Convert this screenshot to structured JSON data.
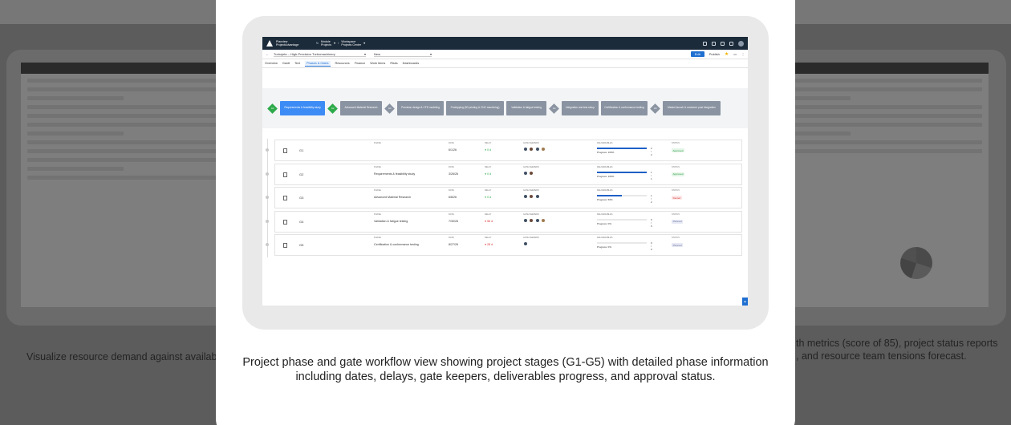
{
  "background": {
    "left_caption": "Visualize resource demand against availab",
    "right_caption": "th metrics (score of 85), project status reports\n, and resource team tensions forecast."
  },
  "modal": {
    "caption": "Project phase and gate workflow view showing project stages (G1-G5) with detailed phase information including dates, delays, gate keepers, deliverables progress, and approval status."
  },
  "app": {
    "brand_line1": "Planview",
    "brand_line2": "ProjectAdvantage",
    "nav": [
      {
        "label_line1": "Module",
        "label_line2": "Projects"
      },
      {
        "label_line1": "Workspace",
        "label_line2": "Projects Center"
      }
    ],
    "project_select": "Turbojets – High-Precision Turbomachinery",
    "view_select": "New",
    "edit_label": "Edit",
    "publish_label": "Publish",
    "tabs": [
      "Overview",
      "Gantt",
      "Text",
      "Phases & Gates",
      "Resources",
      "Finance",
      "Work Items",
      "Risks",
      "Dashboards"
    ],
    "active_tab": "Phases & Gates",
    "workflow": [
      {
        "kind": "gate",
        "label": "G1",
        "state": "done"
      },
      {
        "kind": "stage",
        "label": "Requirements & feasibility study",
        "state": "active"
      },
      {
        "kind": "gate",
        "label": "G2",
        "state": "done"
      },
      {
        "kind": "stage",
        "label": "Advanced Material Research",
        "state": "todo"
      },
      {
        "kind": "gate",
        "label": "G3",
        "state": "todo"
      },
      {
        "kind": "stage",
        "label": "Precision design & CFD modeling",
        "state": "todo"
      },
      {
        "kind": "stage",
        "label": "Prototyping (3D printing & CNC machining)",
        "state": "todo"
      },
      {
        "kind": "stage",
        "label": "Validation & fatigue testing",
        "state": "todo"
      },
      {
        "kind": "gate",
        "label": "G4",
        "state": "todo"
      },
      {
        "kind": "stage",
        "label": "Integration and test setup",
        "state": "todo"
      },
      {
        "kind": "stage",
        "label": "Certification & conformance testing",
        "state": "todo"
      },
      {
        "kind": "gate",
        "label": "G5",
        "state": "todo"
      },
      {
        "kind": "stage",
        "label": "Market launch & customer post integration",
        "state": "todo"
      }
    ],
    "column_labels": {
      "phase": "Phase",
      "date": "Date",
      "delay": "Delay",
      "gatekeepers": "Gate Keepers",
      "deliverables": "Deliverables",
      "status": "Status"
    },
    "gates": [
      {
        "id": "G1",
        "phase": "",
        "date": "6/1/26",
        "delay": "0 d",
        "delay_state": "ok",
        "keepers": 4,
        "done": 2,
        "total": 2,
        "progress": "Progress: 100%",
        "pct": 1.0,
        "status": "Approved",
        "status_kind": "approved"
      },
      {
        "id": "G2",
        "phase": "Requirements & feasibility study",
        "date": "3/26/26",
        "delay": "0 d",
        "delay_state": "ok",
        "keepers": 2,
        "done": 1,
        "total": 1,
        "progress": "Progress: 100%",
        "pct": 1.0,
        "status": "Approved",
        "status_kind": "approved"
      },
      {
        "id": "G3",
        "phase": "Advanced Material Research",
        "date": "6/8/26",
        "delay": "0 d",
        "delay_state": "ok",
        "keepers": 3,
        "done": 1,
        "total": 2,
        "progress": "Progress: 50%",
        "pct": 0.5,
        "status": "Denied",
        "status_kind": "denied"
      },
      {
        "id": "G4",
        "phase": "Validation & fatigue testing",
        "date": "7/30/26",
        "delay": "56 d",
        "delay_state": "bad",
        "keepers": 4,
        "done": 0,
        "total": 0,
        "progress": "Progress: 0%",
        "pct": 0.0,
        "status": "Planned",
        "status_kind": "planned"
      },
      {
        "id": "G5",
        "phase": "Certification & conformance testing",
        "date": "8/27/26",
        "delay": "28 d",
        "delay_state": "bad",
        "keepers": 1,
        "done": 0,
        "total": 0,
        "progress": "Progress: 0%",
        "pct": 0.0,
        "status": "Planned",
        "status_kind": "planned"
      }
    ]
  }
}
